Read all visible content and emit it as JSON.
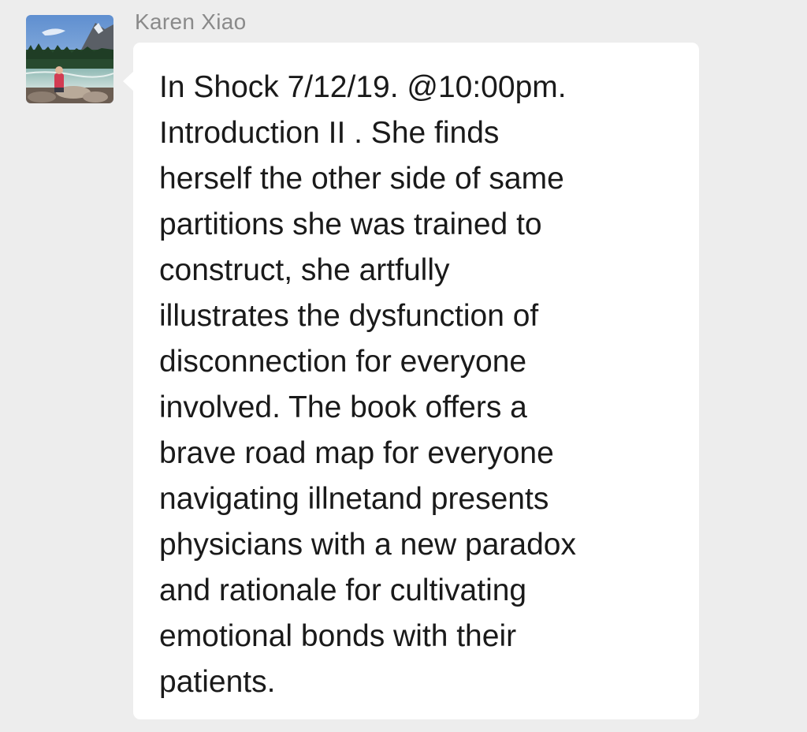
{
  "message": {
    "sender_name": "Karen Xiao",
    "avatar_icon": "profile-photo-mountain-lake-icon",
    "lines": [
      "In Shock 7/12/19.  @10:00pm.",
      "Introduction II . She finds",
      "herself the other side of same",
      "partitions she was trained to",
      "construct, she artfully",
      "illustrates the dysfunction of",
      "disconnection for everyone",
      "involved. The book offers a",
      "brave road map for everyone",
      "navigating illnetand presents",
      "physicians with a new paradox",
      "and rationale for cultivating",
      "emotional bonds with their",
      "patients."
    ]
  },
  "colors": {
    "background": "#ededed",
    "bubble": "#ffffff",
    "text": "#1a1a1a",
    "sender_name": "#8a8a8a"
  }
}
